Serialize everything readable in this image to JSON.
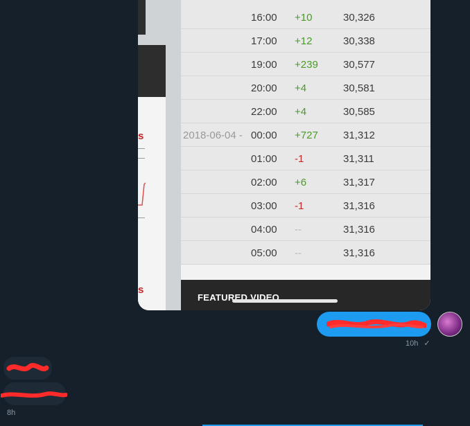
{
  "screenshot": {
    "rows": [
      {
        "date": "",
        "time": "16:00",
        "delta": "+10",
        "delta_type": "pos",
        "total": "30,326"
      },
      {
        "date": "",
        "time": "17:00",
        "delta": "+12",
        "delta_type": "pos",
        "total": "30,338"
      },
      {
        "date": "",
        "time": "19:00",
        "delta": "+239",
        "delta_type": "pos",
        "total": "30,577"
      },
      {
        "date": "",
        "time": "20:00",
        "delta": "+4",
        "delta_type": "pos",
        "total": "30,581"
      },
      {
        "date": "",
        "time": "22:00",
        "delta": "+4",
        "delta_type": "pos",
        "total": "30,585"
      },
      {
        "date": "2018-06-04 -",
        "time": "00:00",
        "delta": "+727",
        "delta_type": "pos",
        "total": "31,312"
      },
      {
        "date": "",
        "time": "01:00",
        "delta": "-1",
        "delta_type": "neg",
        "total": "31,311"
      },
      {
        "date": "",
        "time": "02:00",
        "delta": "+6",
        "delta_type": "pos",
        "total": "31,317"
      },
      {
        "date": "",
        "time": "03:00",
        "delta": "-1",
        "delta_type": "neg",
        "total": "31,316"
      },
      {
        "date": "",
        "time": "04:00",
        "delta": "--",
        "delta_type": "nil",
        "total": "31,316"
      },
      {
        "date": "",
        "time": "05:00",
        "delta": "--",
        "delta_type": "nil",
        "total": "31,316"
      }
    ],
    "featured_label": "FEATURED VIDEO",
    "partial_letters": [
      "s",
      "s"
    ]
  },
  "conversation": {
    "sent_time": "10h",
    "sent_status_icon": "check-icon",
    "sent_status": "✓",
    "received_time": "8h"
  },
  "colors": {
    "background": "#16202b",
    "accent": "#1d9bf0",
    "positive": "#4a9a2a",
    "negative": "#c62828"
  }
}
